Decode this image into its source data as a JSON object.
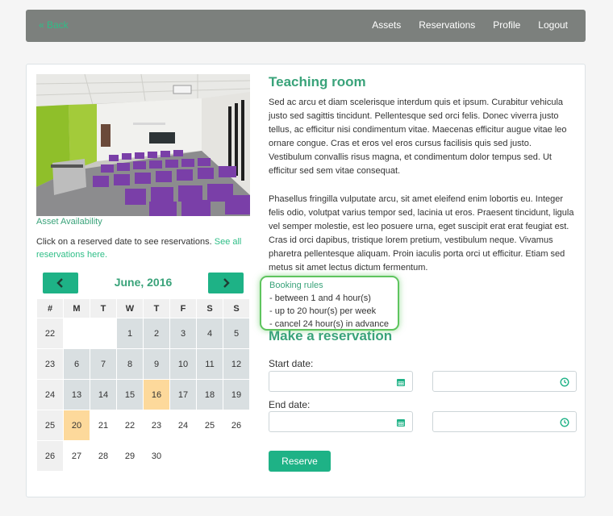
{
  "topbar": {
    "back": "« Back",
    "nav": [
      "Assets",
      "Reservations",
      "Profile",
      "Logout"
    ]
  },
  "asset": {
    "availability_label": "Asset Availability",
    "click_text": "Click on a reserved date to see reservations.",
    "see_all": "See all reservations here."
  },
  "calendar": {
    "month": "June, 2016",
    "weekday_headers": [
      "#",
      "M",
      "T",
      "W",
      "T",
      "F",
      "S",
      "S"
    ],
    "weeks": [
      {
        "num": "22",
        "days": [
          "",
          "",
          "1",
          "2",
          "3",
          "4",
          "5"
        ]
      },
      {
        "num": "23",
        "days": [
          "6",
          "7",
          "8",
          "9",
          "10",
          "11",
          "12"
        ]
      },
      {
        "num": "24",
        "days": [
          "13",
          "14",
          "15",
          "16",
          "17",
          "18",
          "19"
        ]
      },
      {
        "num": "25",
        "days": [
          "20",
          "21",
          "22",
          "23",
          "24",
          "25",
          "26"
        ]
      },
      {
        "num": "26",
        "days": [
          "27",
          "28",
          "29",
          "30",
          "",
          "",
          ""
        ]
      }
    ]
  },
  "room": {
    "title": "Teaching room",
    "para1": "Sed ac arcu et diam scelerisque interdum quis et ipsum. Curabitur vehicula justo sed sagittis tincidunt. Pellentesque sed orci felis. Donec viverra justo tellus, ac efficitur nisi condimentum vitae. Maecenas efficitur augue vitae leo ornare congue. Cras et eros vel eros cursus facilisis quis sed justo. Vestibulum convallis risus magna, et condimentum dolor tempus sed. Ut efficitur sed sem vitae consequat.",
    "para2": "Phasellus fringilla vulputate arcu, sit amet eleifend enim lobortis eu. Integer felis odio, volutpat varius tempor sed, lacinia ut eros. Praesent tincidunt, ligula vel semper molestie, est leo posuere urna, eget suscipit erat erat feugiat est. Cras id orci dapibus, tristique lorem pretium, vestibulum neque. Vivamus pharetra pellentesque aliquam. Proin iaculis porta orci ut efficitur. Etiam sed metus sit amet lectus dictum fermentum."
  },
  "rules": {
    "heading": "Booking rules",
    "items": [
      "- between 1 and 4 hour(s)",
      "- up to 20 hour(s) per week",
      "- cancel 24 hour(s) in advance"
    ]
  },
  "reservation": {
    "heading": "Make a reservation",
    "start_label": "Start date:",
    "end_label": "End date:",
    "reserve_button": "Reserve"
  },
  "colors": {
    "accent": "#1eb286",
    "heading": "#3aa37a",
    "reserved_day": "#d9dfe1",
    "highlight_day": "#fdd99b",
    "rules_border": "#5ec45e"
  }
}
